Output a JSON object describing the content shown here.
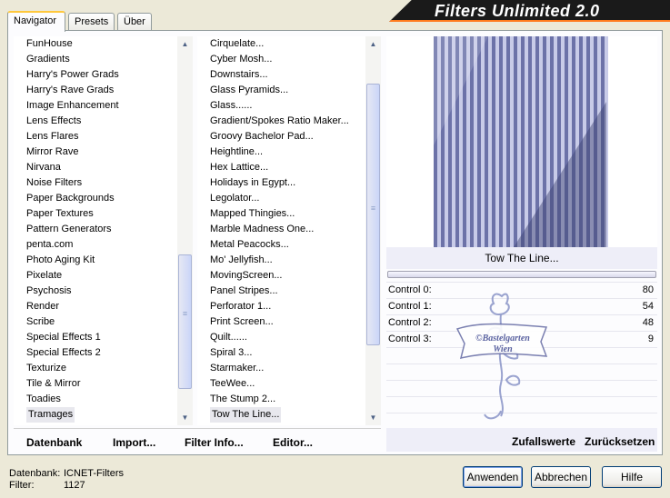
{
  "title": "Filters Unlimited 2.0",
  "tabs": [
    "Navigator",
    "Presets",
    "Über"
  ],
  "categories": [
    "FunHouse",
    "Gradients",
    "Harry's Power Grads",
    "Harry's Rave Grads",
    "Image Enhancement",
    "Lens Effects",
    "Lens Flares",
    "Mirror Rave",
    "Nirvana",
    "Noise Filters",
    "Paper Backgrounds",
    "Paper Textures",
    "Pattern Generators",
    "penta.com",
    "Photo Aging Kit",
    "Pixelate",
    "Psychosis",
    "Render",
    "Scribe",
    "Special Effects 1",
    "Special Effects 2",
    "Texturize",
    "Tile & Mirror",
    "Toadies",
    "Tramages"
  ],
  "selected_category": "Tramages",
  "filters": [
    "Cirquelate...",
    "Cyber Mosh...",
    "Downstairs...",
    "Glass Pyramids...",
    "Glass......",
    "Gradient/Spokes Ratio Maker...",
    "Groovy Bachelor Pad...",
    "Heightline...",
    "Hex Lattice...",
    "Holidays in Egypt...",
    "Legolator...",
    "Mapped Thingies...",
    "Marble Madness One...",
    "Metal Peacocks...",
    "Mo' Jellyfish...",
    "MovingScreen...",
    "Panel Stripes...",
    "Perforator 1...",
    "Print Screen...",
    "Quilt......",
    "Spiral 3...",
    "Starmaker...",
    "TeeWee...",
    "The Stump 2...",
    "Tow The Line..."
  ],
  "selected_filter": "Tow The Line...",
  "filter_name": "Tow The Line...",
  "controls": [
    {
      "label": "Control 0:",
      "value": "80"
    },
    {
      "label": "Control 1:",
      "value": "54"
    },
    {
      "label": "Control 2:",
      "value": "48"
    },
    {
      "label": "Control 3:",
      "value": "9"
    }
  ],
  "left_links": {
    "datenbank": "Datenbank",
    "import": "Import...",
    "filter_info": "Filter Info...",
    "editor": "Editor..."
  },
  "right_links": {
    "random": "Zufallswerte",
    "reset": "Zurücksetzen"
  },
  "status": {
    "db_label": "Datenbank:",
    "db_value": "ICNET-Filters",
    "filter_label": "Filter:",
    "filter_value": "1127"
  },
  "buttons": {
    "apply": "Anwenden",
    "cancel": "Abbrechen",
    "help": "Hilfe"
  },
  "watermark": {
    "line1": "©Bastelgarten",
    "line2": "Wien"
  },
  "colors": {
    "preview_stripe_light": "#c8cbe8",
    "preview_stripe_dark": "#6c72a8",
    "accent_orange": "#ff7b1e"
  }
}
